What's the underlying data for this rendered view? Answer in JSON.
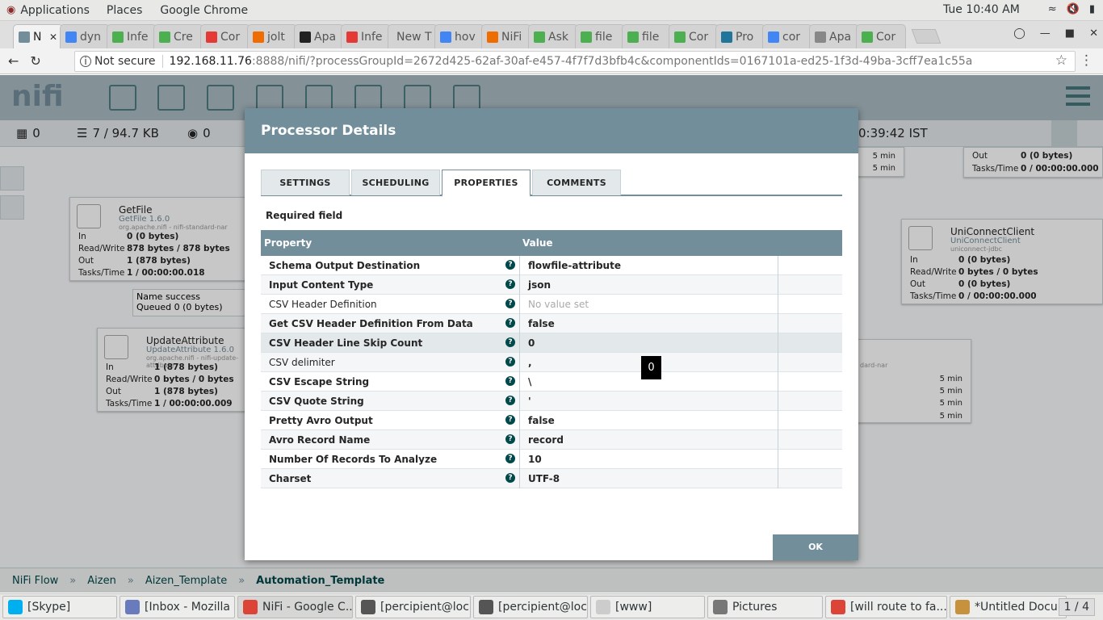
{
  "gnome": {
    "menus": [
      "Applications",
      "Places",
      "Google Chrome"
    ],
    "clock": "Tue 10:40 AM",
    "tray_icons": [
      "wifi-icon",
      "volume-muted-icon",
      "battery-icon"
    ]
  },
  "chrome": {
    "tabs": [
      {
        "label": "N",
        "icon_color": "#728e9b",
        "active": true
      },
      {
        "label": "dyn",
        "icon_color": "#4285f4"
      },
      {
        "label": "Infe",
        "icon_color": "#4caf50"
      },
      {
        "label": "Cre",
        "icon_color": "#4caf50"
      },
      {
        "label": "Cor",
        "icon_color": "#e53935"
      },
      {
        "label": "jolt",
        "icon_color": "#ef6c00"
      },
      {
        "label": "Apa",
        "icon_color": "#222222"
      },
      {
        "label": "Infe",
        "icon_color": "#e53935"
      },
      {
        "label": "New T",
        "icon_color": ""
      },
      {
        "label": "hov",
        "icon_color": "#4285f4"
      },
      {
        "label": "NiFi",
        "icon_color": "#ef6c00"
      },
      {
        "label": "Ask",
        "icon_color": "#4caf50"
      },
      {
        "label": "file",
        "icon_color": "#4caf50"
      },
      {
        "label": "file",
        "icon_color": "#4caf50"
      },
      {
        "label": "Cor",
        "icon_color": "#4caf50"
      },
      {
        "label": "Pro",
        "icon_color": "#21759b"
      },
      {
        "label": "cor",
        "icon_color": "#4285f4"
      },
      {
        "label": "Apa",
        "icon_color": "#888888"
      },
      {
        "label": "Cor",
        "icon_color": "#4caf50"
      }
    ],
    "security": "Not secure",
    "url_host": "192.168.11.76",
    "url_path": ":8888/nifi/?processGroupId=2672d425-62af-30af-e457-4f7f7d3bfb4c&componentIds=0167101a-ed25-1f3d-49ba-3cff7ea1c55a"
  },
  "nifi": {
    "logo": "nifi",
    "status": {
      "a": "0",
      "queued": "7 / 94.7 KB",
      "b": "0",
      "time": "0:39:42 IST"
    },
    "processors": [
      {
        "name": "GetFile",
        "type": "GetFile 1.6.0",
        "bundle": "org.apache.nifi - nifi-standard-nar",
        "stats": [
          [
            "In",
            "0 (0 bytes)"
          ],
          [
            "Read/Write",
            "878 bytes / 878 bytes"
          ],
          [
            "Out",
            "1 (878 bytes)"
          ],
          [
            "Tasks/Time",
            "1 / 00:00:00.018"
          ]
        ]
      },
      {
        "name": "UpdateAttribute",
        "type": "UpdateAttribute 1.6.0",
        "bundle": "org.apache.nifi - nifi-update-attribute",
        "stats": [
          [
            "In",
            "1 (878 bytes)"
          ],
          [
            "Read/Write",
            "0 bytes / 0 bytes"
          ],
          [
            "Out",
            "1 (878 bytes)"
          ],
          [
            "Tasks/Time",
            "1 / 00:00:00.009"
          ]
        ]
      },
      {
        "name": "UniConnectClient",
        "type": "UniConnectClient",
        "bundle": "uniconnect-jdbc",
        "stats": [
          [
            "In",
            "0 (0 bytes)"
          ],
          [
            "Read/Write",
            "0 bytes / 0 bytes"
          ],
          [
            "Out",
            "0 (0 bytes)"
          ],
          [
            "Tasks/Time",
            "0 / 00:00:00.000"
          ]
        ]
      }
    ],
    "top_right_stats": [
      [
        "Out",
        "0 (0 bytes)"
      ],
      [
        "Tasks/Time",
        "0 / 00:00:00.000"
      ]
    ],
    "five_min": "5 min",
    "connection": {
      "name_label": "Name",
      "name": "success",
      "queued_label": "Queued",
      "queued": "0 (0 bytes)"
    },
    "right_bundle_fragment": "dard-nar",
    "breadcrumbs": [
      "NiFi Flow",
      "Aizen",
      "Aizen_Template",
      "Automation_Template"
    ],
    "breadcrumb_sep": "»"
  },
  "dialog": {
    "title": "Processor Details",
    "tabs": [
      "SETTINGS",
      "SCHEDULING",
      "PROPERTIES",
      "COMMENTS"
    ],
    "active_tab": "PROPERTIES",
    "required_label": "Required field",
    "columns": {
      "property": "Property",
      "value": "Value"
    },
    "properties": [
      {
        "name": "Schema Output Destination",
        "value": "flowfile-attribute",
        "required": true
      },
      {
        "name": "Input Content Type",
        "value": "json",
        "required": true
      },
      {
        "name": "CSV Header Definition",
        "value": "No value set",
        "required": false,
        "empty": true
      },
      {
        "name": "Get CSV Header Definition From Data",
        "value": "false",
        "required": true
      },
      {
        "name": "CSV Header Line Skip Count",
        "value": "0",
        "required": true,
        "highlight": true
      },
      {
        "name": "CSV delimiter",
        "value": ",",
        "required": false
      },
      {
        "name": "CSV Escape String",
        "value": "\\",
        "required": true
      },
      {
        "name": "CSV Quote String",
        "value": "'",
        "required": true
      },
      {
        "name": "Pretty Avro Output",
        "value": "false",
        "required": true
      },
      {
        "name": "Avro Record Name",
        "value": "record",
        "required": true
      },
      {
        "name": "Number Of Records To Analyze",
        "value": "10",
        "required": true
      },
      {
        "name": "Charset",
        "value": "UTF-8",
        "required": true
      }
    ],
    "tooltip": "0",
    "ok_label": "OK"
  },
  "taskbar": {
    "tasks": [
      {
        "label": "[Skype]",
        "icon_color": "#00aff0"
      },
      {
        "label": "[Inbox - Mozilla ...",
        "icon_color": "#6a7bbd"
      },
      {
        "label": "NiFi - Google C...",
        "icon_color": "#db4437",
        "active": true
      },
      {
        "label": "[percipient@loc...",
        "icon_color": "#555555"
      },
      {
        "label": "[percipient@loc...",
        "icon_color": "#555555"
      },
      {
        "label": "[www]",
        "icon_color": "#cccccc"
      },
      {
        "label": "Pictures",
        "icon_color": "#777777"
      },
      {
        "label": "[will route to fa...",
        "icon_color": "#db4437"
      },
      {
        "label": "*Untitled Docu...",
        "icon_color": "#c7923e"
      }
    ],
    "pager": "1 / 4"
  }
}
